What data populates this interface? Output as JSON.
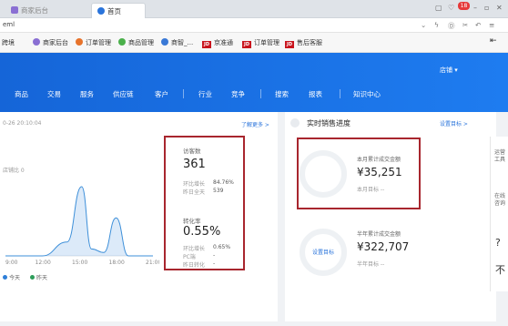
{
  "browser": {
    "tabs": [
      {
        "label": "商家后台"
      },
      {
        "label": "首页"
      }
    ],
    "tab_badge": "18",
    "address": "eml"
  },
  "bookmarks": [
    {
      "label": "跨境"
    },
    {
      "label": "商家后台"
    },
    {
      "label": "订单管理"
    },
    {
      "label": "商品管理"
    },
    {
      "label": "商智_..."
    },
    {
      "label": "京准通",
      "jd": true
    },
    {
      "label": "订单管理",
      "jd": true
    },
    {
      "label": "售后客服",
      "jd": true
    }
  ],
  "jd_logo": "JD",
  "header": {
    "user": "店铺",
    "nav": [
      "商品",
      "交易",
      "服务",
      "供应链",
      "客户",
      "行业",
      "竞争",
      "搜索",
      "报表",
      "知识中心"
    ]
  },
  "left_panel": {
    "timestamp": "0-26 20:10:04",
    "more_link": "了解更多 >",
    "truncated_label": "店铺比 0",
    "x_ticks": [
      "9:00",
      "12:00",
      "15:00",
      "18:00",
      "21:00"
    ],
    "legend": [
      {
        "label": "今天",
        "color": "#2f7fd8"
      },
      {
        "label": "昨天",
        "color": "#2e9d5a"
      }
    ],
    "visitors": {
      "label": "访客数",
      "value": "361",
      "rows": [
        {
          "label": "环比增长",
          "value": "84.76%"
        },
        {
          "label": "昨日全天",
          "value": "539"
        }
      ]
    },
    "conversion": {
      "label": "转化率",
      "value": "0.55%",
      "rows": [
        {
          "label": "环比增长",
          "value": "0.65%"
        },
        {
          "label": "PC端",
          "value": "-"
        },
        {
          "label": "昨日转化",
          "value": "-"
        }
      ]
    }
  },
  "right_panel": {
    "title": "实时销售进度",
    "settings_link": "设置目标 >",
    "month": {
      "label": "本月累计成交金额",
      "value": "¥35,251",
      "target": "本月目标 --"
    },
    "half_year": {
      "label": "半年累计成交金额",
      "value": "¥322,707",
      "target": "半年目标 --",
      "button": "设置目标"
    }
  },
  "side_float": {
    "items": [
      "运营工具",
      "在线咨询"
    ],
    "help": "?",
    "top": "不"
  },
  "chart_data": {
    "type": "line",
    "x_ticks": [
      "9:00",
      "12:00",
      "15:00",
      "18:00",
      "21:00"
    ],
    "series": [
      {
        "name": "今天",
        "points": [
          [
            9,
            0
          ],
          [
            12,
            0
          ],
          [
            14,
            0.2
          ],
          [
            15.2,
            1.0
          ],
          [
            16,
            0.1
          ],
          [
            17,
            0.05
          ],
          [
            18,
            0.55
          ],
          [
            19,
            0
          ],
          [
            21,
            0
          ]
        ]
      }
    ],
    "xlim": [
      9,
      21
    ]
  }
}
